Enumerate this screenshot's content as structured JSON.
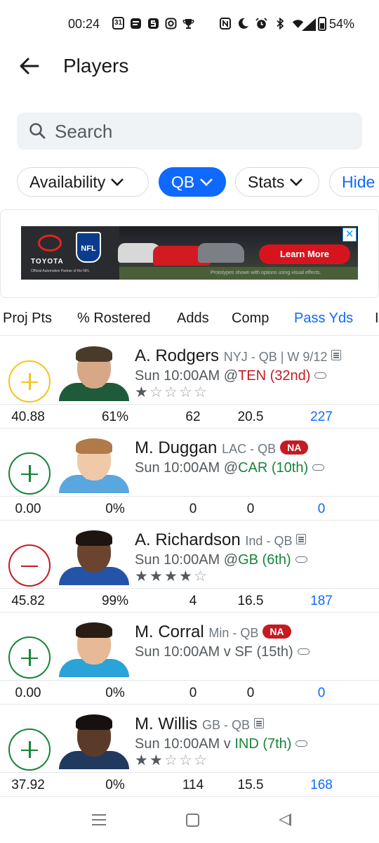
{
  "status_bar": {
    "time": "00:24",
    "left_icons": [
      "calendar-icon",
      "app-icon",
      "app-s-icon",
      "instagram-icon",
      "trophy-icon"
    ],
    "calendar_date": "31",
    "right_icons": [
      "nfc-icon",
      "moon-icon",
      "alarm-icon",
      "bluetooth-icon",
      "wifi-icon",
      "signal-icon",
      "battery-icon"
    ],
    "battery": "54%"
  },
  "header": {
    "title": "Players"
  },
  "search": {
    "placeholder": "Search"
  },
  "filters": [
    {
      "label": "Availability",
      "active": false,
      "dropdown": true
    },
    {
      "label": "QB",
      "active": true,
      "dropdown": true
    },
    {
      "label": "Stats",
      "active": false,
      "dropdown": true
    },
    {
      "label": "Hide",
      "active": false,
      "dropdown": false
    }
  ],
  "ad": {
    "brand": "TOYOTA",
    "tagline": "Official Automotive Partner of the NFL",
    "league_logo": "NFL",
    "cta": "Learn More",
    "disclaimer": "Prototypes shown with options using visual effects.",
    "close": "✕"
  },
  "columns": [
    "Proj Pts",
    "% Rostered",
    "Adds",
    "Comp",
    "Pass Yds",
    "I"
  ],
  "sorted_column": "Pass Yds",
  "players": [
    {
      "name": "A. Rodgers",
      "team_pos": "NYJ - QB | W 9/12",
      "has_note": true,
      "na_badge": "",
      "game_time": "Sun 10:00AM",
      "opponent_prefix": "@",
      "opponent": "TEN (32nd)",
      "opponent_color": "red",
      "action": "pending",
      "stars": 1,
      "stats": [
        "40.88",
        "61%",
        "62",
        "20.5",
        "227"
      ]
    },
    {
      "name": "M. Duggan",
      "team_pos": "LAC - QB",
      "has_note": false,
      "na_badge": "NA",
      "game_time": "Sun 10:00AM",
      "opponent_prefix": "@",
      "opponent": "CAR (10th)",
      "opponent_color": "green",
      "action": "add",
      "stars": 0,
      "stats": [
        "0.00",
        "0%",
        "0",
        "0",
        "0"
      ]
    },
    {
      "name": "A. Richardson",
      "team_pos": "Ind - QB",
      "has_note": true,
      "na_badge": "",
      "game_time": "Sun 10:00AM",
      "opponent_prefix": "@",
      "opponent": "GB (6th)",
      "opponent_color": "green",
      "action": "drop",
      "stars": 4,
      "stats": [
        "45.82",
        "99%",
        "4",
        "16.5",
        "187"
      ]
    },
    {
      "name": "M. Corral",
      "team_pos": "Min - QB",
      "has_note": false,
      "na_badge": "NA",
      "game_time": "Sun 10:00AM",
      "opponent_prefix": "v ",
      "opponent": "SF (15th)",
      "opponent_color": "gray",
      "action": "add",
      "stars": 0,
      "stats": [
        "0.00",
        "0%",
        "0",
        "0",
        "0"
      ]
    },
    {
      "name": "M. Willis",
      "team_pos": "GB - QB",
      "has_note": true,
      "na_badge": "",
      "game_time": "Sun 10:00AM",
      "opponent_prefix": "v ",
      "opponent": "IND (7th)",
      "opponent_color": "green",
      "action": "add",
      "stars": 2,
      "stats": [
        "37.92",
        "0%",
        "114",
        "15.5",
        "168"
      ]
    }
  ],
  "colors": {
    "accent": "#0f69ff",
    "add_green": "#168438",
    "drop_red": "#c61a22",
    "pending_yellow": "#f3c51a",
    "na_badge": "#c61a22"
  },
  "nav": [
    "recent-apps-icon",
    "home-icon",
    "back-icon"
  ]
}
